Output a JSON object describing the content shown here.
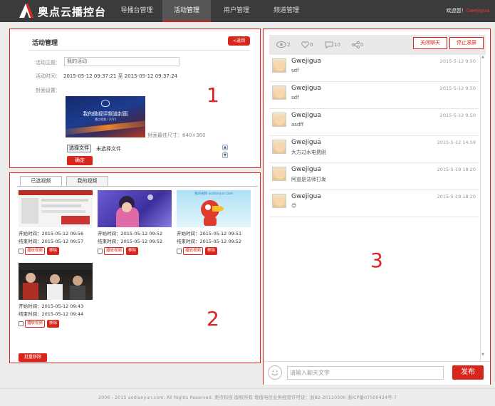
{
  "header": {
    "logo_text": "奥点云播控台",
    "nav": [
      {
        "label": "导播台管理",
        "active": false
      },
      {
        "label": "活动管理",
        "active": true
      },
      {
        "label": "用户管理",
        "active": false
      },
      {
        "label": "频道管理",
        "active": false
      }
    ],
    "welcome": "欢迎您！",
    "username": "Gwejigua"
  },
  "activity": {
    "title": "活动管理",
    "back_label": "<返回",
    "subject_label": "活动主题：",
    "subject_value": "我的活动",
    "time_label": "活动时间：",
    "time_value": "2015-05-12 09:37:21 至 2015-05-12 09:37:24",
    "cover_label": "封面设置：",
    "cover_title": "我的微视评频道封面",
    "cover_subtitle": "播点视频 / 2015",
    "cover_size_hint": "封面最佳尺寸：640×360",
    "file_button": "选择文件",
    "file_status": "未选择文件",
    "confirm_label": "确定",
    "panel_number": "1"
  },
  "videos": {
    "tabs": [
      "已选视频",
      "我的视频"
    ],
    "items": [
      {
        "start": "开始时间：2015-05-12 09:56",
        "end": "结束时间：2015-05-12 09:57"
      },
      {
        "start": "开始时间：2015-05-12 09:52",
        "end": "结束时间：2015-05-12 09:52"
      },
      {
        "start": "开始时间：2015-05-12 09:51",
        "end": "结束时间：2015-05-12 09:52"
      },
      {
        "start": "开始时间：2015-05-12 09:43",
        "end": "结束时间：2015-05-12 09:44"
      }
    ],
    "thumb3_text": "我的视频 aodianyun.com",
    "play_label": "播放视频",
    "remove_label": "移除",
    "batch_label": "批量移除",
    "panel_number": "2"
  },
  "chat": {
    "stats": {
      "views": "2",
      "likes": "0",
      "comments": "10",
      "shares": "0"
    },
    "close_chat_label": "关闭聊天",
    "stop_scroll_label": "停止滚屏",
    "messages": [
      {
        "name": "Gwejigua",
        "time": "2015-5-12 9:50",
        "text": "sdf"
      },
      {
        "name": "Gwejigua",
        "time": "2015-5-12 9:50",
        "text": "sdf"
      },
      {
        "name": "Gwejigua",
        "time": "2015-5-12 9:50",
        "text": "asdff"
      },
      {
        "name": "Gwejigua",
        "time": "2015-5-12 14:59",
        "text": "大方过水电费刚"
      },
      {
        "name": "Gwejigua",
        "time": "2015-5-19 18:20",
        "text": "阿道是法师打发"
      },
      {
        "name": "Gwejigua",
        "time": "2015-5-19 18:20",
        "text": "😊"
      }
    ],
    "input_placeholder": "请输入聊天文字",
    "send_label": "发布",
    "panel_number": "3"
  },
  "footer": {
    "text": "2006 - 2015 aodianyun.com, All Rights Reserved. 奥点科技 版权所有 增值电信业务经营许可证：浙B2-20110306 浙ICP备07500424号-7"
  },
  "colors": {
    "accent": "#d9261c",
    "topbar": "#3b3b3b",
    "page_bg": "#ececec"
  }
}
